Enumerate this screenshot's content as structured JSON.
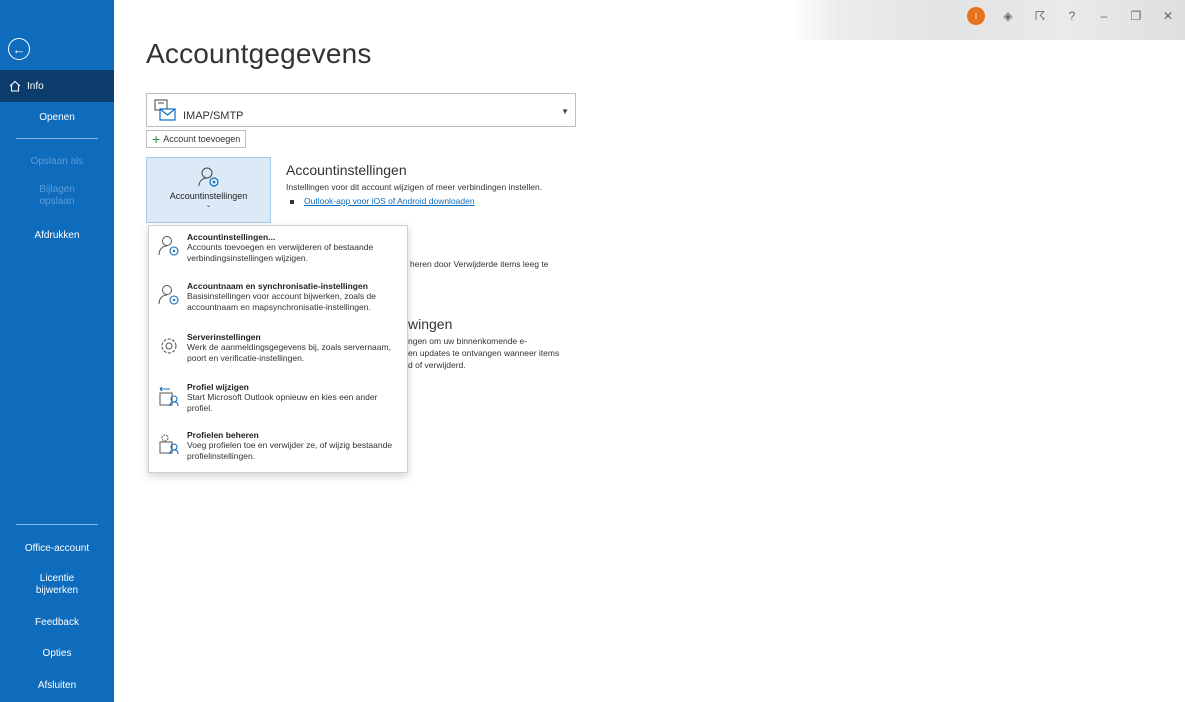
{
  "sidebar": {
    "back_label": "",
    "info": "Info",
    "open": "Openen",
    "save_as": "Opslaan als",
    "save_attachments": "Bijlagen opslaan",
    "print": "Afdrukken",
    "office_account": "Office-account",
    "license_update": "Licentie bijwerken",
    "feedback": "Feedback",
    "options": "Opties",
    "exit": "Afsluiten"
  },
  "titlebar": {
    "avatar_initial": "I",
    "icons": [
      "diamond-icon",
      "coauthor-icon",
      "help-icon",
      "minimize-icon",
      "restore-icon",
      "close-icon"
    ]
  },
  "main": {
    "title": "Accountgegevens",
    "account_selector": {
      "value": "IMAP/SMTP"
    },
    "add_account": "Account toevoegen",
    "account_settings_button": "Accountinstellingen",
    "account_settings_section": {
      "title": "Accountinstellingen",
      "description": "Instellingen voor dit account wijzigen of meer verbindingen instellen.",
      "link": "Outlook-app voor iOS of Android downloaden"
    },
    "partial_mailbox_text": "heren door Verwijderde items leeg te",
    "partial_rules_title": "wingen",
    "partial_rules_desc": [
      "ngen om uw binnenkomende e-",
      "en updates te ontvangen wanneer items",
      "d of verwijderd."
    ]
  },
  "dropdown": {
    "items": [
      {
        "title": "Accountinstellingen...",
        "desc": "Accounts toevoegen en verwijderen of bestaande verbindingsinstellingen wijzigen."
      },
      {
        "title": "Accountnaam en synchronisatie-instellingen",
        "desc": "Basisinstellingen voor account bijwerken, zoals de accountnaam en mapsynchronisatie-instellingen."
      },
      {
        "title": "Serverinstellingen",
        "desc": "Werk de aanmeldingsgegevens bij, zoals servernaam, poort en verificatie-instellingen."
      },
      {
        "title": "Profiel wijzigen",
        "desc": "Start Microsoft Outlook opnieuw en kies een ander profiel."
      },
      {
        "title": "Profielen beheren",
        "desc": "Voeg profielen toe en verwijder ze, of wijzig bestaande profielinstellingen."
      }
    ]
  },
  "colors": {
    "sidebar": "#0f6cbd",
    "sidebar_active": "#0b3c6b",
    "button_selected": "#dceaf8",
    "link": "#0f6cbd",
    "avatar": "#e8731f"
  }
}
